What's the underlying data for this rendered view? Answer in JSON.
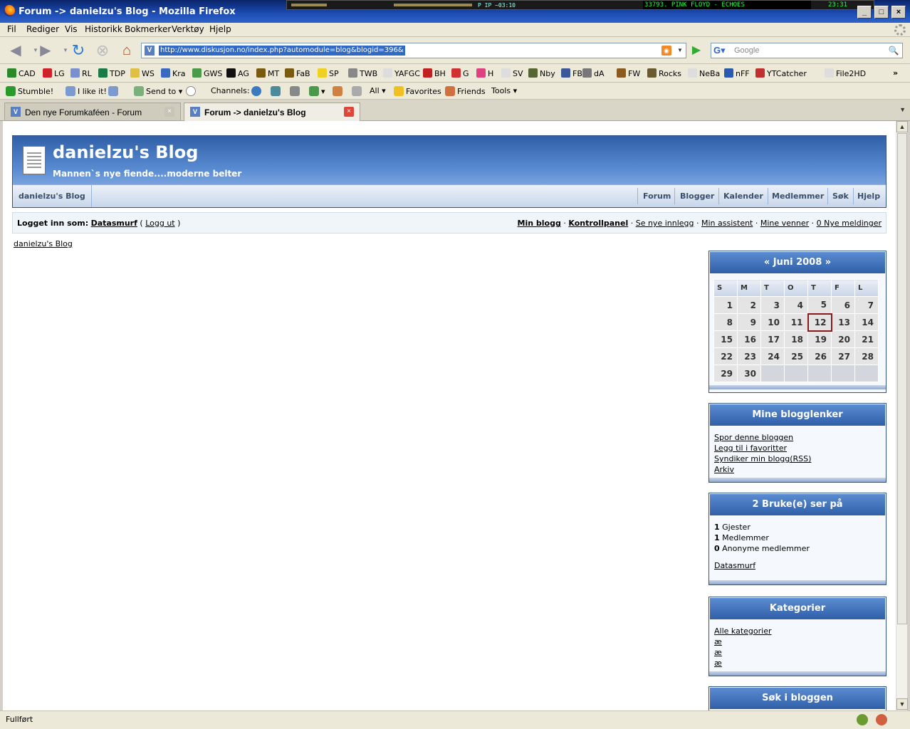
{
  "window": {
    "title": "Forum -> danielzu's Blog - Mozilla Firefox",
    "winamp_track": "33793. PINK FLOYD - ECHOES",
    "winamp_time": "23:31",
    "winamp_mid": "P IP ~03:10"
  },
  "menu": [
    "Fil",
    "Rediger",
    "Vis",
    "Historikk",
    "Bokmerker",
    "Verktøy",
    "Hjelp"
  ],
  "nav": {
    "url": "http://www.diskusjon.no/index.php?automodule=blog&blogid=396&",
    "search_placeholder": "Google"
  },
  "bookmarks": [
    {
      "label": "CAD",
      "color": "#2a8a2a"
    },
    {
      "label": "LG",
      "color": "#d0202a"
    },
    {
      "label": "RL",
      "color": "#7a8fd0"
    },
    {
      "label": "TDP",
      "color": "#1a7a4a"
    },
    {
      "label": "WS",
      "color": "#e0c040"
    },
    {
      "label": "Kra",
      "color": "#3a6ac0"
    },
    {
      "label": "GWS",
      "color": "#4a9a4a"
    },
    {
      "label": "AG",
      "color": "#111111"
    },
    {
      "label": "MT",
      "color": "#7a5a10"
    },
    {
      "label": "FaB",
      "color": "#7a5a10"
    },
    {
      "label": "SP",
      "color": "#f0d020"
    },
    {
      "label": "TWB",
      "color": "#888888"
    },
    {
      "label": "YAFGC",
      "color": "#dddddd"
    },
    {
      "label": "BH",
      "color": "#c02020"
    },
    {
      "label": "G",
      "color": "#d03030"
    },
    {
      "label": "H",
      "color": "#e04080"
    },
    {
      "label": "SV",
      "color": "#dddddd"
    },
    {
      "label": "Nby",
      "color": "#556633"
    },
    {
      "label": "FB",
      "color": "#3b5998"
    },
    {
      "label": "dA",
      "color": "#777777"
    },
    {
      "label": "FW",
      "color": "#8a5a20"
    },
    {
      "label": "Rocks",
      "color": "#6a5a30"
    },
    {
      "label": "NeBa",
      "color": "#dddddd"
    },
    {
      "label": "nFF",
      "color": "#2a5ab0"
    },
    {
      "label": "YTCatcher",
      "color": "#c03030"
    },
    {
      "label": "File2HD",
      "color": "#dddddd"
    }
  ],
  "stumble": {
    "stumble_label": "Stumble!",
    "like_label": "I like it!",
    "sendto_label": "Send to",
    "channels_label": "Channels:",
    "all_label": "All",
    "favorites_label": "Favorites",
    "friends_label": "Friends",
    "tools_label": "Tools"
  },
  "tabs": [
    {
      "label": "Den nye Forumkaféen - Forum",
      "active": false
    },
    {
      "label": "Forum -> danielzu's Blog",
      "active": true
    }
  ],
  "blog": {
    "name": "danielzu's Blog",
    "description": "Mannen`s nye fiende....moderne belter",
    "crumb": "danielzu's Blog",
    "top_nav": [
      "Forum",
      "Blogger",
      "Kalender",
      "Medlemmer",
      "Søk",
      "Hjelp"
    ]
  },
  "userbar": {
    "logged_in_as": "Logget inn som:",
    "username": "Datasmurf",
    "logout": "Logg ut",
    "links": [
      "Min blogg",
      "Kontrollpanel",
      "Se nye innlegg",
      "Min assistent",
      "Mine venner",
      "0 Nye meldinger"
    ]
  },
  "breadcrumb": "danielzu's Blog",
  "calendar": {
    "title": "« Juni 2008 »",
    "weekdays": [
      "S",
      "M",
      "T",
      "O",
      "T",
      "F",
      "L"
    ],
    "weeks": [
      [
        "1",
        "2",
        "3",
        "4",
        "5",
        "6",
        "7"
      ],
      [
        "8",
        "9",
        "10",
        "11",
        "12",
        "13",
        "14"
      ],
      [
        "15",
        "16",
        "17",
        "18",
        "19",
        "20",
        "21"
      ],
      [
        "22",
        "23",
        "24",
        "25",
        "26",
        "27",
        "28"
      ],
      [
        "29",
        "30",
        "",
        "",
        "",
        "",
        ""
      ]
    ],
    "today": "12"
  },
  "blog_links": {
    "title": "Mine blogglenker",
    "items": [
      "Spor denne bloggen",
      "Legg til i favoritter",
      "Syndiker min blogg(RSS)",
      "Arkiv"
    ]
  },
  "viewers": {
    "title": "2 Bruke(e) ser på",
    "guests_count": "1",
    "guests_label": "Gjester",
    "members_count": "1",
    "members_label": "Medlemmer",
    "anon_count": "0",
    "anon_label": "Anonyme medlemmer",
    "user": "Datasmurf"
  },
  "categories": {
    "title": "Kategorier",
    "items": [
      "Alle kategorier",
      "æ",
      "æ",
      "æ"
    ]
  },
  "search_box": {
    "title": "Søk i bloggen"
  },
  "status": "Fullført"
}
